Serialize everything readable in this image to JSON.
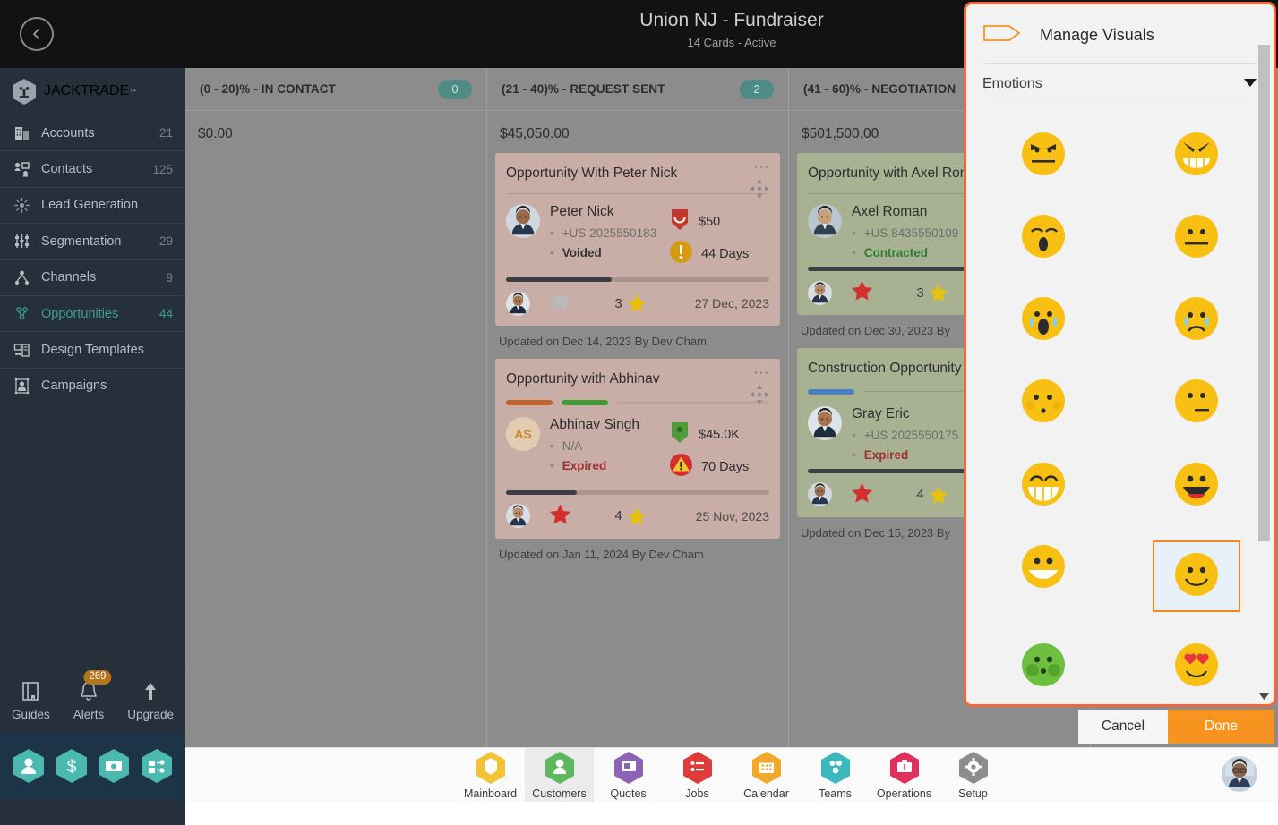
{
  "sidebar": {
    "back_icon": "chevron-left-icon",
    "brand": "JACKTRADE",
    "brand_tm": "™",
    "items": [
      {
        "label": "Accounts",
        "count": "21",
        "icon": "building-icon",
        "active": false
      },
      {
        "label": "Contacts",
        "count": "125",
        "icon": "contacts-icon",
        "active": false
      },
      {
        "label": "Lead Generation",
        "count": "",
        "icon": "lead-gen-icon",
        "active": false
      },
      {
        "label": "Segmentation",
        "count": "29",
        "icon": "segmentation-icon",
        "active": false
      },
      {
        "label": "Channels",
        "count": "9",
        "icon": "channels-icon",
        "active": false
      },
      {
        "label": "Opportunities",
        "count": "44",
        "icon": "opportunities-icon",
        "active": true
      },
      {
        "label": "Design Templates",
        "count": "",
        "icon": "templates-icon",
        "active": false
      },
      {
        "label": "Campaigns",
        "count": "",
        "icon": "campaigns-icon",
        "active": false
      }
    ],
    "tools": [
      {
        "label": "Guides",
        "icon": "book-icon",
        "badge": ""
      },
      {
        "label": "Alerts",
        "icon": "bell-icon",
        "badge": "269"
      },
      {
        "label": "Upgrade",
        "icon": "arrow-up-icon",
        "badge": ""
      }
    ],
    "hex_buttons": [
      {
        "icon": "person-hex-icon"
      },
      {
        "icon": "dollar-hex-icon"
      },
      {
        "icon": "payment-hex-icon"
      },
      {
        "icon": "workflow-hex-icon"
      }
    ]
  },
  "header": {
    "title": "Union NJ - Fundraiser",
    "subtitle": "14 Cards - Active",
    "next_icon": "chevron-right-icon"
  },
  "board": {
    "columns": [
      {
        "title": "(0 - 20)% - IN CONTACT",
        "count": "0",
        "total": "$0.00",
        "cards": []
      },
      {
        "title": "(21 - 40)% - REQUEST SENT",
        "count": "2",
        "total": "$45,050.00",
        "cards": [
          {
            "theme": "tan",
            "title": "Opportunity With Peter Nick",
            "bars": [],
            "separator": true,
            "person_name": "Peter Nick",
            "avatar_type": "photo",
            "avatar_initials": "",
            "phone": "+US 2025550183",
            "status": "Voided",
            "status_kind": "dark",
            "amount": "$50",
            "amount_icon": "red-shield-icon",
            "days": "44 Days",
            "days_icon": "amber-warning-icon",
            "progress_pct": 40,
            "star_left": "grey",
            "star_right_count": "3",
            "date": "27 Dec, 2023",
            "updated": "Updated on Dec 14, 2023 By Dev Cham"
          },
          {
            "theme": "tan",
            "title": "Opportunity with Abhinav",
            "bars": [
              "#c4622d",
              "#3f9c35"
            ],
            "separator": false,
            "person_name": "Abhinav Singh",
            "avatar_type": "initials",
            "avatar_initials": "AS",
            "phone": "N/A",
            "status": "Expired",
            "status_kind": "red",
            "amount": "$45.0K",
            "amount_icon": "green-shield-icon",
            "days": "70 Days",
            "days_icon": "red-warning-icon",
            "progress_pct": 27,
            "star_left": "red",
            "star_right_count": "4",
            "date": "25 Nov, 2023",
            "updated": "Updated on Jan 11, 2024 By Dev Cham"
          }
        ]
      },
      {
        "title": "(41 - 60)% - NEGOTIATION",
        "count": "",
        "total": "$501,500.00",
        "cards": [
          {
            "theme": "sage",
            "title": "Opportunity with Axel Roman",
            "bars": [],
            "separator": true,
            "person_name": "Axel Roman",
            "avatar_type": "photo",
            "avatar_initials": "",
            "phone": "+US 8435550109",
            "status": "Contracted",
            "status_kind": "green",
            "amount": "",
            "amount_icon": "",
            "days": "",
            "days_icon": "",
            "progress_pct": 60,
            "star_left": "red",
            "star_right_count": "3",
            "date": "",
            "updated": "Updated on Dec 30, 2023 By"
          },
          {
            "theme": "sage",
            "title": "Construction Opportunity Gray Eric",
            "bars": [
              "#4a80c4"
            ],
            "separator": false,
            "person_name": "Gray Eric",
            "avatar_type": "photo",
            "avatar_initials": "",
            "phone": "+US 2025550175",
            "status": "Expired",
            "status_kind": "red",
            "amount": "",
            "amount_icon": "",
            "days": "",
            "days_icon": "",
            "progress_pct": 85,
            "star_left": "red",
            "star_right_count": "4",
            "date": "",
            "updated": "Updated on Dec 15, 2023 By"
          }
        ]
      }
    ]
  },
  "modal": {
    "tag_icon": "label-tag-icon",
    "title": "Manage Visuals",
    "category_selected": "Emotions",
    "dropdown_icon": "chevron-down-icon",
    "cancel_label": "Cancel",
    "done_label": "Done",
    "emojis": [
      {
        "name": "angry-face",
        "selected": false
      },
      {
        "name": "rage-grimace-face",
        "selected": false
      },
      {
        "name": "yawning-face",
        "selected": false
      },
      {
        "name": "neutral-face",
        "selected": false
      },
      {
        "name": "loudly-crying-face",
        "selected": false
      },
      {
        "name": "sad-tear-face",
        "selected": false
      },
      {
        "name": "blushing-shy-face",
        "selected": false
      },
      {
        "name": "smirk-face",
        "selected": false
      },
      {
        "name": "beaming-grin-face",
        "selected": false
      },
      {
        "name": "open-laugh-face",
        "selected": false
      },
      {
        "name": "big-smile-face",
        "selected": false
      },
      {
        "name": "slight-smile-face",
        "selected": true
      },
      {
        "name": "nauseated-face",
        "selected": false
      },
      {
        "name": "heart-eyes-face",
        "selected": false
      }
    ]
  },
  "bottom_nav": {
    "items": [
      {
        "label": "Mainboard",
        "icon": "mainboard-icon",
        "color": "#f2c335",
        "active": false
      },
      {
        "label": "Customers",
        "icon": "customers-icon",
        "color": "#5cb85c",
        "active": true
      },
      {
        "label": "Quotes",
        "icon": "quotes-icon",
        "color": "#8e63b5",
        "active": false
      },
      {
        "label": "Jobs",
        "icon": "jobs-icon",
        "color": "#e03b3b",
        "active": false
      },
      {
        "label": "Calendar",
        "icon": "calendar-icon",
        "color": "#f0a92b",
        "active": false
      },
      {
        "label": "Teams",
        "icon": "teams-icon",
        "color": "#3ab8bd",
        "active": false
      },
      {
        "label": "Operations",
        "icon": "operations-icon",
        "color": "#e0315e",
        "active": false
      },
      {
        "label": "Setup",
        "icon": "setup-icon",
        "color": "#8d8d8d",
        "active": false
      }
    ],
    "user_avatar": "user-avatar"
  },
  "colors": {
    "accent_orange": "#f4673a",
    "done_orange": "#f79420",
    "sidebar_bg": "#25303b",
    "board_bg": "#8c8c8c",
    "teal": "#4d8b84",
    "active_nav": "#3d9e8f"
  }
}
